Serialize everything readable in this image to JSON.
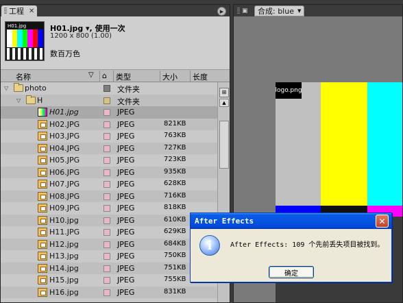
{
  "project_panel": {
    "tab_label": "工程",
    "tab_close": "✕",
    "preview": {
      "thumb_label": "H01.jpg",
      "filename": "H01.jpg ▾, 使用一次",
      "dimensions": "1200 x 800 (1.00)",
      "colors": "数百万色"
    },
    "columns": {
      "name": "名称",
      "type": "类型",
      "size": "大小",
      "duration": "长度"
    },
    "rows": [
      {
        "name": "photo",
        "type": "文件夹",
        "size": ""
      },
      {
        "name": "H",
        "type": "文件夹",
        "size": ""
      },
      {
        "name": "H01.jpg",
        "type": "JPEG",
        "size": ""
      },
      {
        "name": "H02.JPG",
        "type": "JPEG",
        "size": "821KB"
      },
      {
        "name": "H03.JPG",
        "type": "JPEG",
        "size": "763KB"
      },
      {
        "name": "H04.JPG",
        "type": "JPEG",
        "size": "727KB"
      },
      {
        "name": "H05.JPG",
        "type": "JPEG",
        "size": "723KB"
      },
      {
        "name": "H06.JPG",
        "type": "JPEG",
        "size": "935KB"
      },
      {
        "name": "H07.JPG",
        "type": "JPEG",
        "size": "628KB"
      },
      {
        "name": "H08.JPG",
        "type": "JPEG",
        "size": "716KB"
      },
      {
        "name": "H09.JPG",
        "type": "JPEG",
        "size": "818KB"
      },
      {
        "name": "H10.jpg",
        "type": "JPEG",
        "size": "610KB"
      },
      {
        "name": "H11.JPG",
        "type": "JPEG",
        "size": "629KB"
      },
      {
        "name": "H12.jpg",
        "type": "JPEG",
        "size": "684KB"
      },
      {
        "name": "H13.jpg",
        "type": "JPEG",
        "size": "750KB"
      },
      {
        "name": "H14.jpg",
        "type": "JPEG",
        "size": "751KB"
      },
      {
        "name": "H15.jpg",
        "type": "JPEG",
        "size": "755KB"
      },
      {
        "name": "H16.jpg",
        "type": "JPEG",
        "size": "831KB"
      }
    ]
  },
  "comp_panel": {
    "tab_label": "合成: blue",
    "dropdown_arrow": "▼",
    "logo_tag": "logo.png"
  },
  "dialog": {
    "title": "After Effects",
    "close": "✕",
    "icon_glyph": "i",
    "message": "After Effects: 109 个先前丢失项目被找到。",
    "ok_label": "确定"
  }
}
